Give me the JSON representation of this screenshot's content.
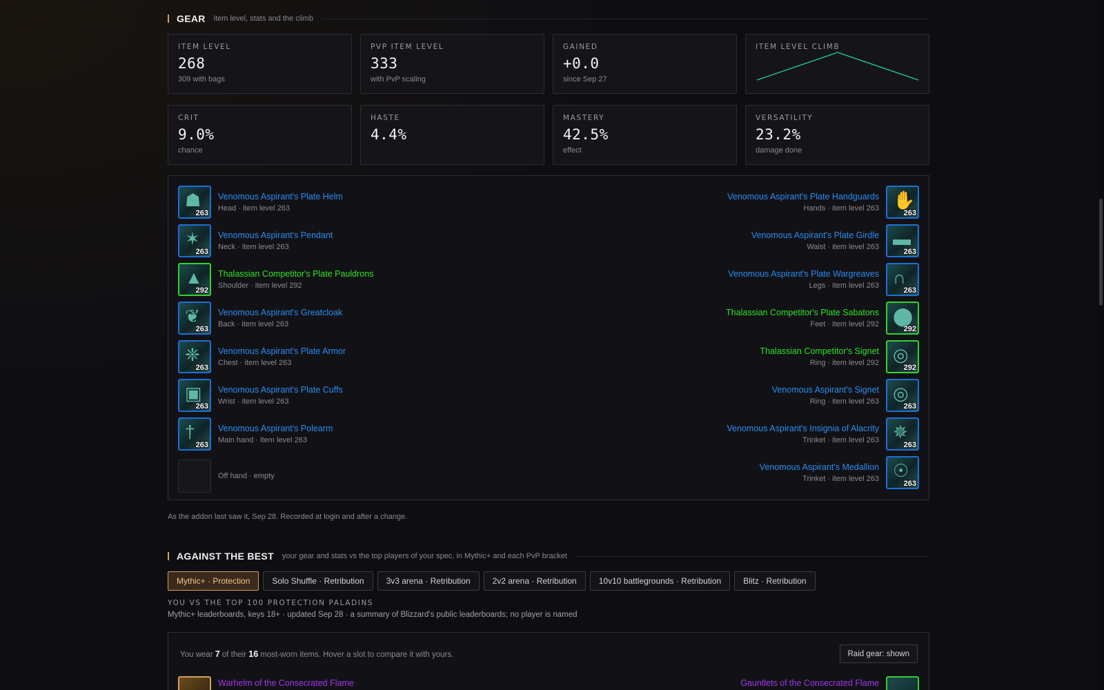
{
  "gear_section": {
    "title": "GEAR",
    "subtitle": "item level, stats and the climb"
  },
  "summary_cards": [
    {
      "label": "ITEM LEVEL",
      "value": "268",
      "note": "309 with bags"
    },
    {
      "label": "PVP ITEM LEVEL",
      "value": "333",
      "note": "with PvP scaling"
    },
    {
      "label": "GAINED",
      "value": "+0.0",
      "note": "since Sep 27"
    },
    {
      "label": "ITEM LEVEL CLIMB",
      "value": "",
      "note": ""
    }
  ],
  "climb_sparkline": {
    "color": "#21c99a",
    "values": [
      0,
      1,
      0
    ]
  },
  "stat_cards": [
    {
      "label": "CRIT",
      "value": "9.0%",
      "note": "chance"
    },
    {
      "label": "HASTE",
      "value": "4.4%",
      "note": ""
    },
    {
      "label": "MASTERY",
      "value": "42.5%",
      "note": "effect"
    },
    {
      "label": "VERSATILITY",
      "value": "23.2%",
      "note": "damage done"
    }
  ],
  "gear_left": [
    {
      "name": "Venomous Aspirant's Plate Helm",
      "meta": "Head · item level 263",
      "ilvl": "263",
      "quality": "rare",
      "icon": "helm-icon"
    },
    {
      "name": "Venomous Aspirant's Pendant",
      "meta": "Neck · item level 263",
      "ilvl": "263",
      "quality": "rare",
      "icon": "pendant-icon"
    },
    {
      "name": "Thalassian Competitor's Plate Pauldrons",
      "meta": "Shoulder · item level 292",
      "ilvl": "292",
      "quality": "uncommon",
      "icon": "pauldrons-icon"
    },
    {
      "name": "Venomous Aspirant's Greatcloak",
      "meta": "Back · item level 263",
      "ilvl": "263",
      "quality": "rare",
      "icon": "cloak-icon"
    },
    {
      "name": "Venomous Aspirant's Plate Armor",
      "meta": "Chest · item level 263",
      "ilvl": "263",
      "quality": "rare",
      "icon": "chest-armor-icon"
    },
    {
      "name": "Venomous Aspirant's Plate Cuffs",
      "meta": "Wrist · item level 263",
      "ilvl": "263",
      "quality": "rare",
      "icon": "cuffs-icon"
    },
    {
      "name": "Venomous Aspirant's Polearm",
      "meta": "Main hand · item level 263",
      "ilvl": "263",
      "quality": "rare",
      "icon": "polearm-icon"
    }
  ],
  "offhand": {
    "meta": "Off hand · empty"
  },
  "gear_right": [
    {
      "name": "Venomous Aspirant's Plate Handguards",
      "meta": "Hands · item level 263",
      "ilvl": "263",
      "quality": "rare",
      "icon": "handguards-icon"
    },
    {
      "name": "Venomous Aspirant's Plate Girdle",
      "meta": "Waist · item level 263",
      "ilvl": "263",
      "quality": "rare",
      "icon": "girdle-icon"
    },
    {
      "name": "Venomous Aspirant's Plate Wargreaves",
      "meta": "Legs · item level 263",
      "ilvl": "263",
      "quality": "rare",
      "icon": "legs-icon"
    },
    {
      "name": "Thalassian Competitor's Plate Sabatons",
      "meta": "Feet · item level 292",
      "ilvl": "292",
      "quality": "uncommon",
      "icon": "boots-icon"
    },
    {
      "name": "Thalassian Competitor's Signet",
      "meta": "Ring · item level 292",
      "ilvl": "292",
      "quality": "uncommon",
      "icon": "ring-icon"
    },
    {
      "name": "Venomous Aspirant's Signet",
      "meta": "Ring · item level 263",
      "ilvl": "263",
      "quality": "rare",
      "icon": "ring-icon"
    },
    {
      "name": "Venomous Aspirant's Insignia of Alacrity",
      "meta": "Trinket · item level 263",
      "ilvl": "263",
      "quality": "rare",
      "icon": "insignia-icon"
    },
    {
      "name": "Venomous Aspirant's Medallion",
      "meta": "Trinket · item level 263",
      "ilvl": "263",
      "quality": "rare",
      "icon": "medallion-icon"
    }
  ],
  "quality_colors": {
    "rare": "#2a8cf0",
    "uncommon": "#33e02a",
    "epic": "#a335ee"
  },
  "footnote": "As the addon last saw it, Sep 28. Recorded at login and after a change.",
  "best_section": {
    "title": "AGAINST THE BEST",
    "subtitle": "your gear and stats vs the top players of your spec, in Mythic+ and each PvP bracket"
  },
  "tabs": [
    {
      "label": "Mythic+ · Protection",
      "active": true
    },
    {
      "label": "Solo Shuffle · Retribution",
      "active": false
    },
    {
      "label": "3v3 arena · Retribution",
      "active": false
    },
    {
      "label": "2v2 arena · Retribution",
      "active": false
    },
    {
      "label": "10v10 battlegrounds · Retribution",
      "active": false
    },
    {
      "label": "Blitz · Retribution",
      "active": false
    }
  ],
  "vs": {
    "label": "YOU VS THE TOP 100 PROTECTION PALADINS",
    "desc": "Mythic+ leaderboards, keys 18+ · updated Sep 28 · a summary of Blizzard's public leaderboards; no player is named"
  },
  "compare": {
    "prefix": "You wear",
    "worn": "7",
    "of_their": "of their",
    "total": "16",
    "suffix": "most-worn items. Hover a slot to compare it with yours.",
    "raid_button": "Raid gear: shown",
    "left_item": "Warhelm of the Consecrated Flame",
    "right_item": "Gauntlets of the Consecrated Flame"
  }
}
